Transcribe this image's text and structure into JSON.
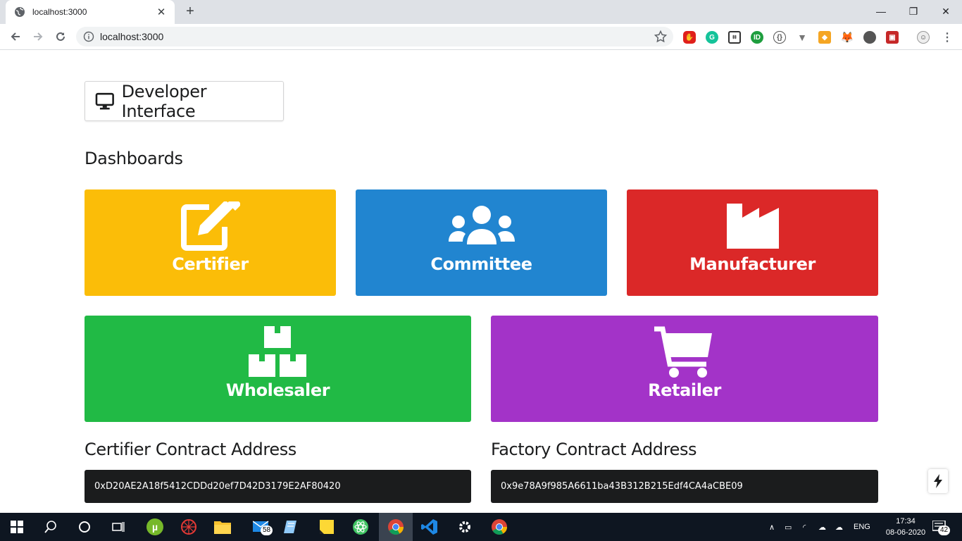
{
  "browser": {
    "tab_title": "localhost:3000",
    "new_tab": "+",
    "url": "localhost:3000",
    "window_controls": [
      "—",
      "❐",
      "✕"
    ]
  },
  "page": {
    "dev_button": "Developer Interface",
    "dashboards_heading": "Dashboards",
    "cards": [
      {
        "label": "Certifier",
        "icon": "edit-icon",
        "color": "#fbbd08"
      },
      {
        "label": "Committee",
        "icon": "users-icon",
        "color": "#2185d0"
      },
      {
        "label": "Manufacturer",
        "icon": "factory-icon",
        "color": "#db2828"
      },
      {
        "label": "Wholesaler",
        "icon": "boxes-icon",
        "color": "#21ba45"
      },
      {
        "label": "Retailer",
        "icon": "cart-icon",
        "color": "#a333c8"
      }
    ],
    "certifier_heading": "Certifier Contract Address",
    "certifier_address": "0xD20AE2A18f5412CDDd20ef7D42D3179E2AF80420",
    "factory_heading": "Factory Contract Address",
    "factory_address": "0x9e78A9f985A6611ba43B312B215Edf4CA4aCBE09"
  },
  "taskbar": {
    "mail_badge": "58",
    "lang": "ENG",
    "time": "17:34",
    "date": "08-06-2020",
    "notification_count": "42"
  }
}
